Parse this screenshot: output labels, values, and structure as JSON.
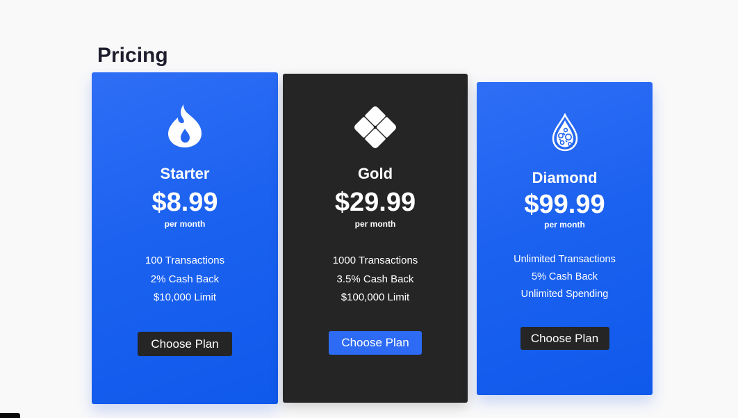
{
  "page": {
    "title": "Pricing"
  },
  "colors": {
    "accent_blue": "#1c62f0",
    "dark_card": "#252525",
    "background": "#f9f9fa",
    "title_text": "#1e1e2e"
  },
  "plans": [
    {
      "name": "Starter",
      "price": "$8.99",
      "period": "per month",
      "icon": "flame-icon",
      "features": [
        "100 Transactions",
        "2% Cash Back",
        "$10,000 Limit"
      ],
      "button_label": "Choose Plan"
    },
    {
      "name": "Gold",
      "price": "$29.99",
      "period": "per month",
      "icon": "diamond-grid-icon",
      "features": [
        "1000 Transactions",
        "3.5% Cash Back",
        "$100,000 Limit"
      ],
      "button_label": "Choose Plan"
    },
    {
      "name": "Diamond",
      "price": "$99.99",
      "period": "per month",
      "icon": "droplet-icon",
      "features": [
        "Unlimited Transactions",
        "5% Cash Back",
        "Unlimited Spending"
      ],
      "button_label": "Choose Plan"
    }
  ]
}
